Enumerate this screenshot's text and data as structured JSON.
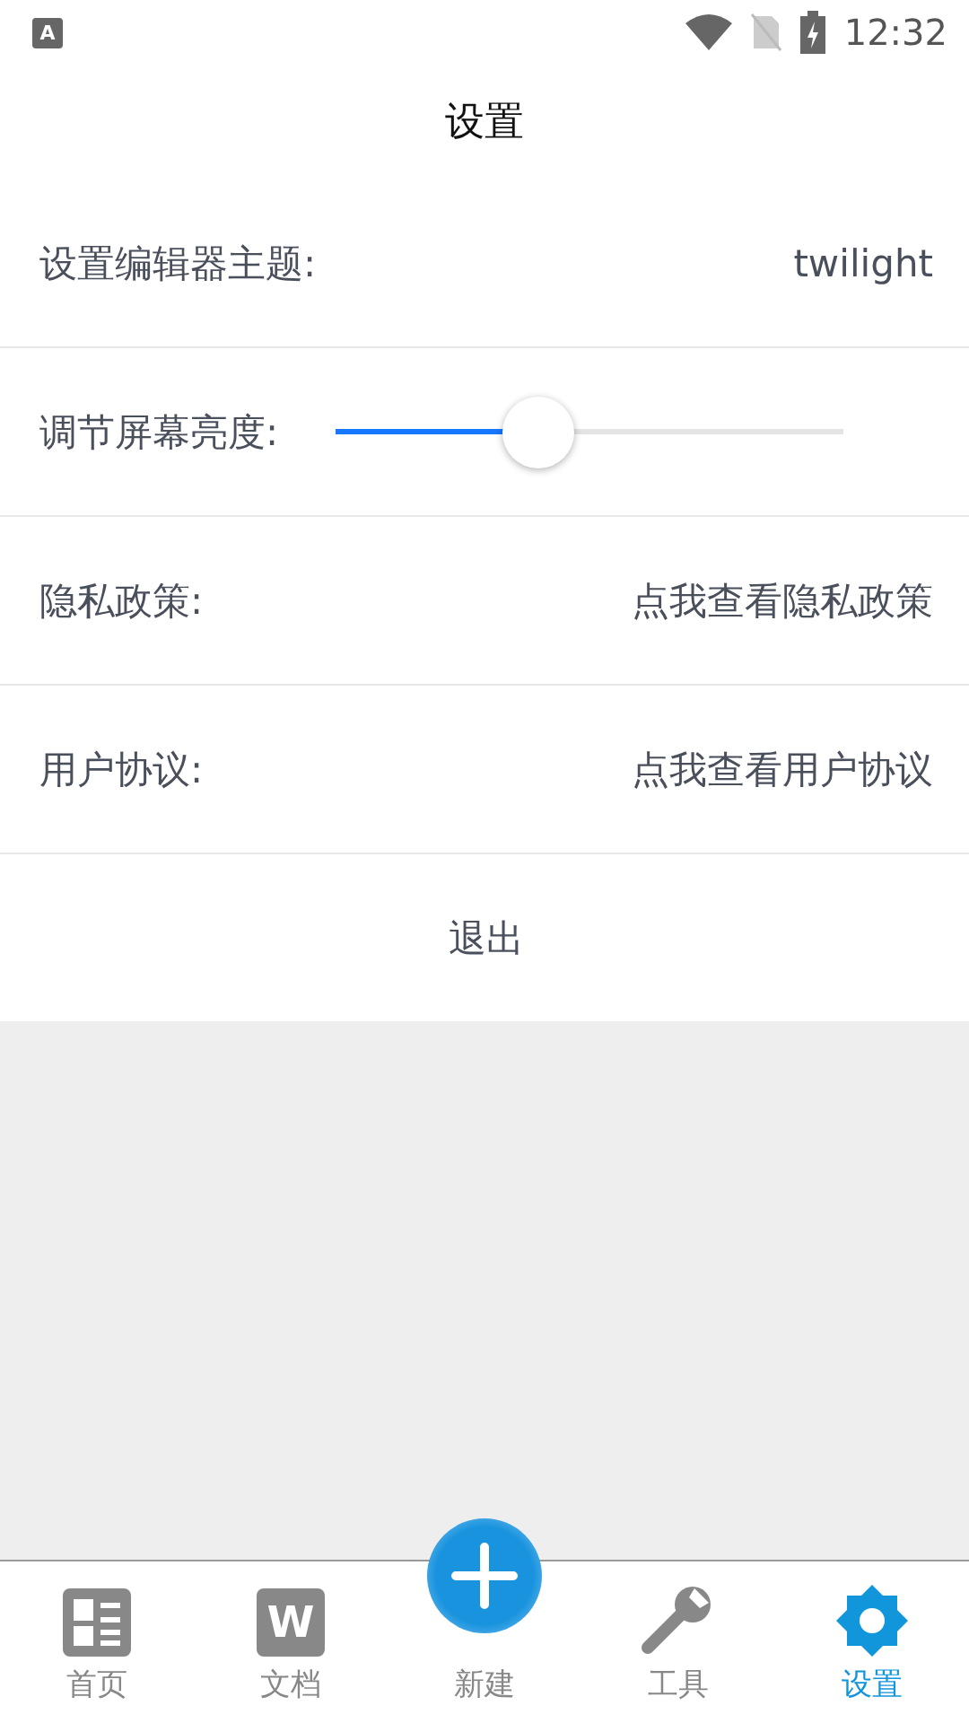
{
  "status_bar": {
    "app_badge": "A",
    "time": "12:32"
  },
  "header": {
    "title": "设置"
  },
  "settings": [
    {
      "kind": "value",
      "label": "设置编辑器主题:",
      "value": "twilight"
    },
    {
      "kind": "slider",
      "label": "调节屏幕亮度:",
      "level": 0.4
    },
    {
      "kind": "link",
      "label": "隐私政策:",
      "value": "点我查看隐私政策"
    },
    {
      "kind": "link",
      "label": "用户协议:",
      "value": "点我查看用户协议"
    },
    {
      "kind": "action",
      "label": "退出"
    }
  ],
  "bottom_nav": [
    {
      "kind": "home",
      "label": "首页",
      "selected": false
    },
    {
      "kind": "document",
      "label": "文档",
      "selected": false,
      "icon_letter": "W"
    },
    {
      "kind": "create",
      "label": "新建",
      "selected": false
    },
    {
      "kind": "tools",
      "label": "工具",
      "selected": false
    },
    {
      "kind": "settings",
      "label": "设置",
      "selected": true
    }
  ]
}
